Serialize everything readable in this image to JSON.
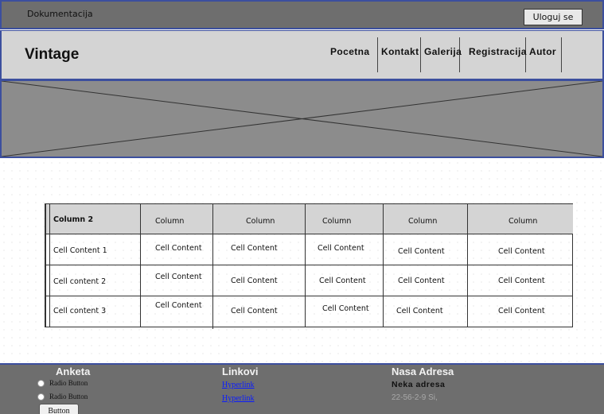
{
  "topbar": {
    "title": "Dokumentacija",
    "login_label": "Uloguj se"
  },
  "header": {
    "brand": "Vintage",
    "nav": [
      "Pocetna",
      "Kontakt",
      "Galerija",
      "Registracija",
      "Autor"
    ]
  },
  "table": {
    "headers": [
      "Column 2",
      "Column",
      "Column",
      "Column",
      "Column",
      "Column"
    ],
    "rows": [
      [
        "Cell Content 1",
        "Cell Content",
        "Cell Content",
        "Cell Content",
        "Cell Content",
        "Cell Content"
      ],
      [
        "Cell content 2",
        "Cell Content",
        "Cell Content",
        "Cell Content",
        "Cell Content",
        "Cell Content"
      ],
      [
        "Cell content 3",
        "Cell Content",
        "Cell Content",
        "Cell Content",
        "Cell Content",
        "Cell Content"
      ]
    ]
  },
  "footer": {
    "poll": {
      "title": "Anketa",
      "options": [
        "Radio Button",
        "Radio Button"
      ],
      "button_label": "Button"
    },
    "links": {
      "title": "Linkovi",
      "items": [
        "Hyperlink",
        "Hyperlink"
      ]
    },
    "address": {
      "title": "Nasa Adresa",
      "line1": "Neka adresa",
      "line2": "22-56-2-9 Si,"
    }
  },
  "colors": {
    "frame_border": "#3c4f9e",
    "topbar_bg": "#6e6e6e",
    "navbar_bg": "#d4d4d4",
    "hero_bg": "#8c8c8c",
    "link": "#0a1cff"
  }
}
